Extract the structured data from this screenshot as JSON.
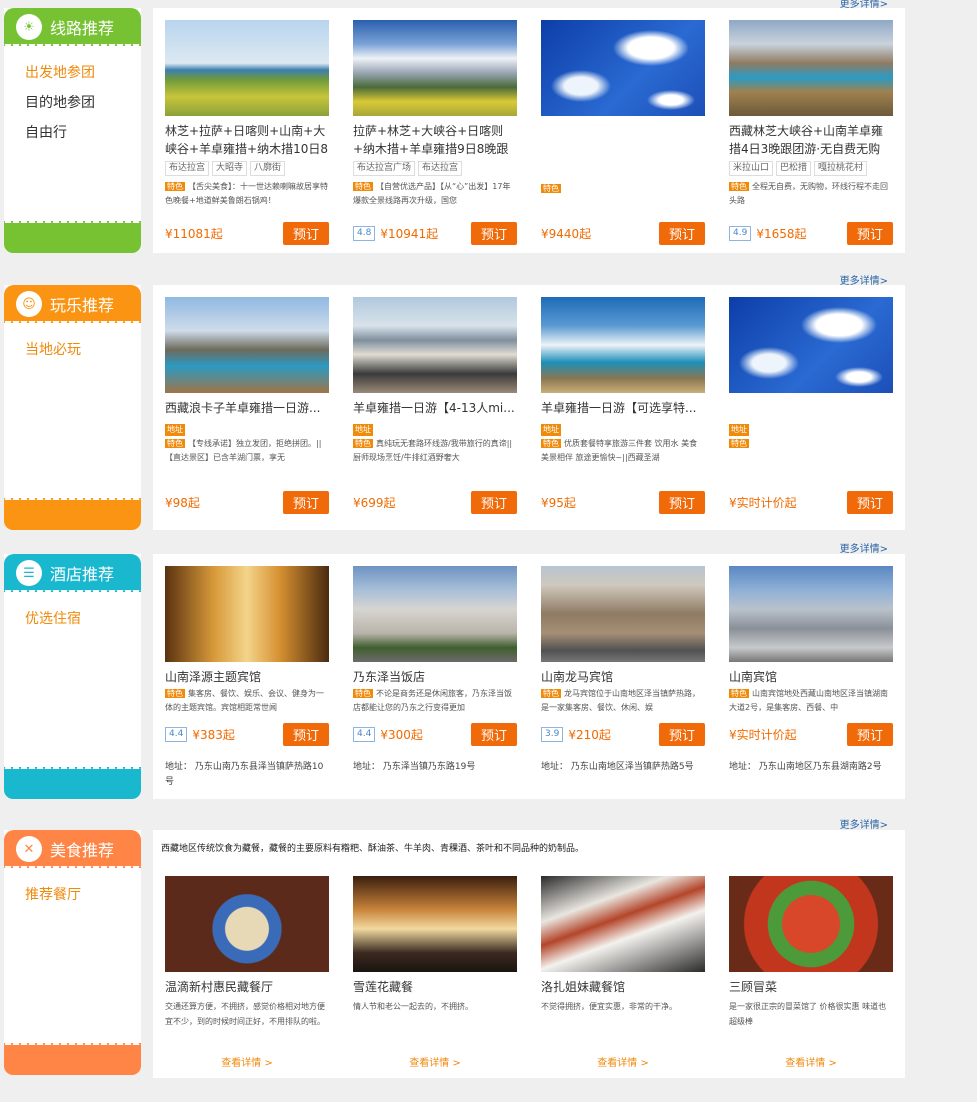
{
  "colors": {
    "green": "#76c233",
    "orange": "#fb9413",
    "cyan": "#1ab8cf",
    "food": "#ff8547",
    "btn": "#f06a0a"
  },
  "route": {
    "title": "线路推荐",
    "icon": "sun-icon",
    "more": "更多详情>",
    "links": [
      "出发地参团",
      "目的地参团",
      "自由行"
    ],
    "cards": [
      {
        "title": "林芝+拉萨+日喀则+山南+大峡谷+羊卓雍措+纳木措10日8",
        "tags": [
          "布达拉宫",
          "大昭寺",
          "八廓街"
        ],
        "badge": "特色",
        "desc": "【舌尖美食】：十一世达赖喇嘛故居享特色晚餐+地道鲜美鲁朗石锅鸡！",
        "score": "",
        "price": "¥11081起",
        "btn": "预订"
      },
      {
        "title": "拉萨+林芝+大峡谷+日喀则+纳木措+羊卓雍措9日8晚跟",
        "tags": [
          "布达拉宫广场",
          "布达拉宫"
        ],
        "badge": "特色",
        "desc": "【自营优选产品】【从“心”出发】17年爆款全景线路再次升级，国您",
        "score": "4.8",
        "price": "¥10941起",
        "btn": "预订"
      },
      {
        "title": "",
        "tags": [],
        "badge": "特色",
        "desc": "",
        "score": "",
        "price": "¥9440起",
        "btn": "预订"
      },
      {
        "title": "西藏林芝大峡谷+山南羊卓雍措4日3晚跟团游·无自费无购",
        "tags": [
          "米拉山口",
          "巴松措",
          "嘎拉桃花村"
        ],
        "badge": "特色",
        "desc": "全程无自费，无购物，环线行程不走回头路",
        "score": "4.9",
        "price": "¥1658起",
        "btn": "预订"
      }
    ]
  },
  "play": {
    "title": "玩乐推荐",
    "icon": "smile-icon",
    "more": "更多详情>",
    "links": [
      "当地必玩"
    ],
    "cards": [
      {
        "title": "西藏浪卡子羊卓雍措一日游...",
        "addr": "地址",
        "badge": "特色",
        "desc": "【专线承诺】独立发团，拒绝拼团。||【直达景区】已含羊湖门票，享无",
        "price": "¥98起",
        "btn": "预订"
      },
      {
        "title": "羊卓雍措一日游【4-13人mi...",
        "addr": "地址",
        "badge": "特色",
        "desc": "真纯玩无套路环线游/我带旅行的真谛||厨师现场烹饪/牛排红酒野奢大",
        "price": "¥699起",
        "btn": "预订"
      },
      {
        "title": "羊卓雍措一日游【可选享特...",
        "addr": "地址",
        "badge": "特色",
        "desc": "优质套餐特享旅游三件套 饮用水 美食美景相伴 旅途更愉快~||西藏圣湖",
        "price": "¥95起",
        "btn": "预订"
      },
      {
        "title": "",
        "addr": "地址",
        "badge": "特色",
        "desc": "",
        "price": "¥实时计价起",
        "btn": "预订"
      }
    ]
  },
  "hotel": {
    "title": "酒店推荐",
    "icon": "bed-icon",
    "more": "更多详情>",
    "links": [
      "优选住宿"
    ],
    "label": "地址：",
    "cards": [
      {
        "title": "山南泽源主题宾馆",
        "badge": "特色",
        "desc": "集客房、餐饮、娱乐、会议、健身为一体的主题宾馆。宾馆相距常世闻",
        "score": "4.4",
        "price": "¥383起",
        "btn": "预订",
        "loc": "乃东山南乃东县泽当镇萨热路10号"
      },
      {
        "title": "乃东泽当饭店",
        "badge": "特色",
        "desc": "不论是商务还是休闲旅客，乃东泽当饭店都能让您的乃东之行变得更加",
        "score": "4.4",
        "price": "¥300起",
        "btn": "预订",
        "loc": "乃东泽当镇乃东路19号"
      },
      {
        "title": "山南龙马宾馆",
        "badge": "特色",
        "desc": "龙马宾馆位于山南地区泽当镇萨热路，是一家集客房、餐饮、休闲、娱",
        "score": "3.9",
        "price": "¥210起",
        "btn": "预订",
        "loc": "乃东山南地区泽当镇萨热路5号"
      },
      {
        "title": "山南宾馆",
        "badge": "特色",
        "desc": "山南宾馆地处西藏山南地区泽当镇湖南大道2号，是集客房、西餐、中",
        "score": "",
        "price": "¥实时计价起",
        "btn": "预订",
        "loc": "乃东山南地区乃东县湖南路2号"
      }
    ]
  },
  "food": {
    "title": "美食推荐",
    "icon": "utensils-icon",
    "more": "更多详情>",
    "links": [
      "推荐餐厅"
    ],
    "intro": "西藏地区传统饮食为藏餐，藏餐的主要原料有糌粑、酥油茶、牛羊肉、青稞酒、茶叶和不同品种的奶制品。",
    "cards": [
      {
        "title": "温滴新村惠民藏餐厅",
        "desc": "交通还算方便，不拥挤，感觉价格相对地方便宜不少，到的时候时间正好，不用排队的啦。",
        "view": "查看详情 >"
      },
      {
        "title": "雪莲花藏餐",
        "desc": "情人节和老公一起去的，不拥挤。",
        "view": "查看详情 >"
      },
      {
        "title": "洛扎姐妹藏餐馆",
        "desc": "不觉得拥挤，便宜实惠，非常的干净。",
        "view": "查看详情 >"
      },
      {
        "title": "三顾冒菜",
        "desc": "是一家很正宗的冒菜馆了 价格很实惠 味道也超级棒",
        "view": "查看详情 >"
      }
    ]
  }
}
